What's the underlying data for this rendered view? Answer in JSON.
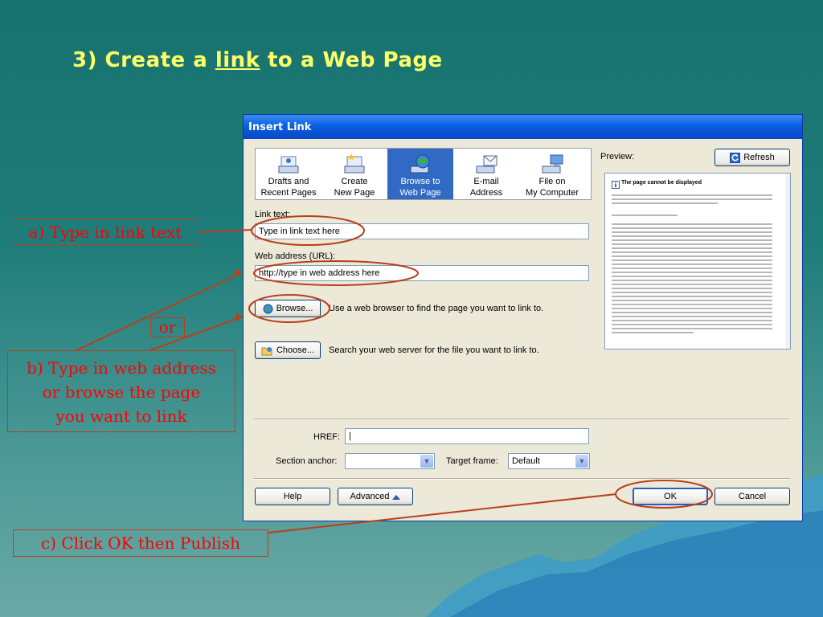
{
  "slide": {
    "title_prefix": "3) Create a ",
    "title_link": "link",
    "title_suffix": " to a Web Page"
  },
  "dialog": {
    "title": "Insert Link",
    "types": [
      {
        "label1": "Drafts and",
        "label2": "Recent Pages",
        "icon": "drafts-icon"
      },
      {
        "label1": "Create",
        "label2": "New Page",
        "icon": "new-page-icon"
      },
      {
        "label1": "Browse to",
        "label2": "Web Page",
        "icon": "globe-icon"
      },
      {
        "label1": "E-mail",
        "label2": "Address",
        "icon": "email-icon"
      },
      {
        "label1": "File on",
        "label2": "My Computer",
        "icon": "computer-icon"
      }
    ],
    "link_text_label": "Link text:",
    "link_text_value": "Type in link text here",
    "web_address_label": "Web address (URL):",
    "web_address_value": "http://type in web address here",
    "browse_label": "Browse...",
    "browse_desc": "Use a web browser to find the page you want to link to.",
    "choose_label": "Choose...",
    "choose_desc": "Search your web server for the file you want to link to.",
    "preview_label": "Preview:",
    "refresh_label": "Refresh",
    "preview_heading": "The page cannot be displayed",
    "href_label": "HREF:",
    "href_value": "|",
    "section_anchor_label": "Section anchor:",
    "section_anchor_value": "",
    "target_frame_label": "Target frame:",
    "target_frame_value": "Default",
    "help_label": "Help",
    "advanced_label": "Advanced",
    "ok_label": "OK",
    "cancel_label": "Cancel"
  },
  "callouts": {
    "a": "a) Type in link text",
    "or": "or",
    "b1": "b) Type in web address",
    "b2": "or browse the page",
    "b3": "you want to link",
    "c": "c) Click OK then Publish"
  },
  "colors": {
    "title": "#ffff66",
    "callout_text": "#ff0000",
    "callout_line": "#b8401c",
    "selected": "#316ac5"
  }
}
